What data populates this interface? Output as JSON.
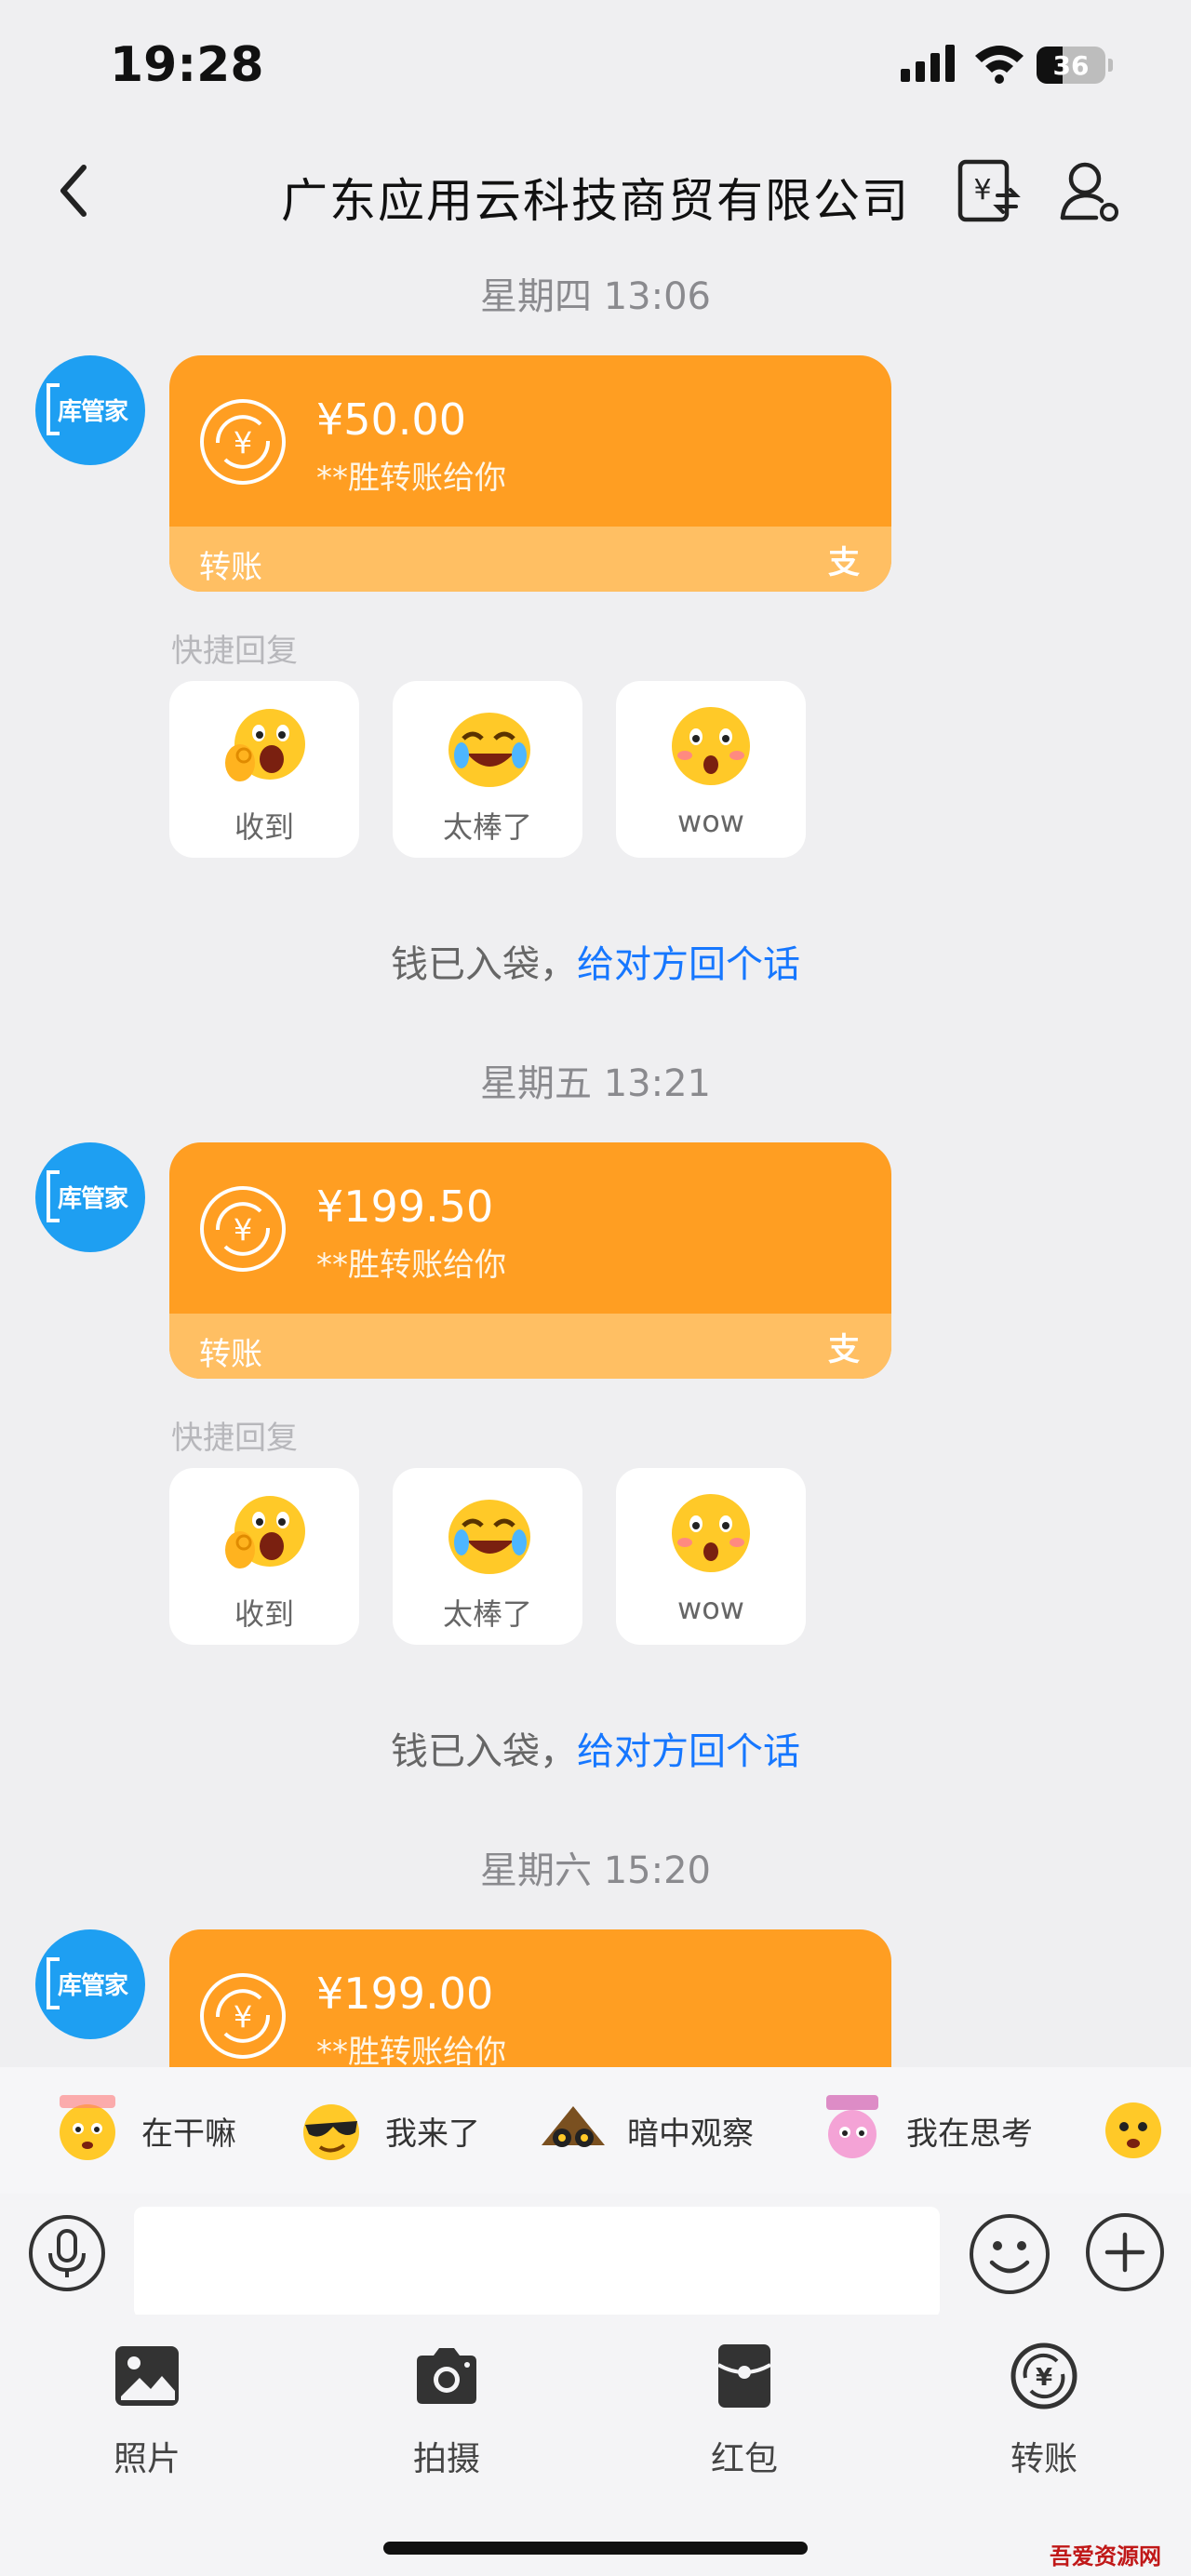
{
  "status_bar": {
    "time": "19:28",
    "battery": "36"
  },
  "nav": {
    "title": "广东应用云科技商贸有限公司"
  },
  "messages": [
    {
      "timestamp": "星期四 13:06",
      "avatar_text": "库管家",
      "card": {
        "amount": "¥50.00",
        "note": "**胜转账给你",
        "kind": "转账"
      },
      "quick_reply_label": "快捷回复",
      "quick_replies": [
        "收到",
        "太棒了",
        "wow"
      ],
      "received_text": "钱已入袋，",
      "reply_link": "给对方回个话"
    },
    {
      "timestamp": "星期五 13:21",
      "avatar_text": "库管家",
      "card": {
        "amount": "¥199.50",
        "note": "**胜转账给你",
        "kind": "转账"
      },
      "quick_reply_label": "快捷回复",
      "quick_replies": [
        "收到",
        "太棒了",
        "wow"
      ],
      "received_text": "钱已入袋，",
      "reply_link": "给对方回个话"
    },
    {
      "timestamp": "星期六 15:20",
      "avatar_text": "库管家",
      "card": {
        "amount": "¥199.00",
        "note": "**胜转账给你"
      }
    }
  ],
  "stickers": [
    "在干嘛",
    "我来了",
    "暗中观察",
    "我在思考"
  ],
  "input": {
    "placeholder": ""
  },
  "actions": [
    "照片",
    "拍摄",
    "红包",
    "转账"
  ],
  "colors": {
    "background": "#efeff1",
    "transfer_card": "#ff9e22",
    "transfer_card_footer": "#ffbf63",
    "avatar": "#1e9ff2",
    "link": "#1677ff"
  },
  "watermark": "吾爱资源网"
}
